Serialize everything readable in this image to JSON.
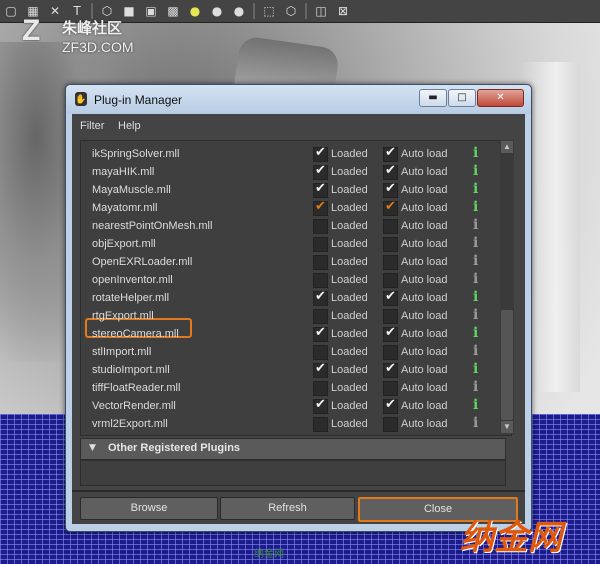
{
  "toolbar": {
    "icons": [
      "select-tool-icon",
      "grid-icon",
      "x-icon",
      "text-icon",
      "wireframe-cube-icon",
      "shaded-cube-icon",
      "textured-cube-icon",
      "checker-icon",
      "light-icon",
      "sphere-icon",
      "sphere-icon",
      "xray-icon",
      "isolate-icon",
      "resolution-gate-icon",
      "film-gate-icon",
      "camera-icon"
    ],
    "glyphs": [
      "▢",
      "▦",
      "✕",
      "T",
      "⬡",
      "■",
      "▣",
      "▩",
      "●",
      "●",
      "●",
      "⬚",
      "⬡",
      "◫",
      "⊠"
    ]
  },
  "watermark_top": {
    "mark": "Z",
    "line1": "朱峰社区",
    "line2": "ZF3D.COM"
  },
  "watermark_bottom": {
    "text": "纳金网"
  },
  "watermark_small": {
    "text": "纳金网"
  },
  "dialog": {
    "title": "Plug-in Manager",
    "window_buttons": {
      "minimize": "▬",
      "maximize": "□",
      "close": "✕"
    },
    "menu": {
      "filter": "Filter",
      "help": "Help"
    },
    "loaded_label": "Loaded",
    "auto_label": "Auto load",
    "info_glyph": "i",
    "plugins": [
      {
        "name": "ikSpringSolver.mll",
        "loaded": true,
        "auto": true
      },
      {
        "name": "mayaHIK.mll",
        "loaded": true,
        "auto": true
      },
      {
        "name": "MayaMuscle.mll",
        "loaded": true,
        "auto": true
      },
      {
        "name": "Mayatomr.mll",
        "loaded": true,
        "auto": true,
        "highlighted": true
      },
      {
        "name": "nearestPointOnMesh.mll",
        "loaded": false,
        "auto": false
      },
      {
        "name": "objExport.mll",
        "loaded": false,
        "auto": false
      },
      {
        "name": "OpenEXRLoader.mll",
        "loaded": false,
        "auto": false
      },
      {
        "name": "openInventor.mll",
        "loaded": false,
        "auto": false
      },
      {
        "name": "rotateHelper.mll",
        "loaded": true,
        "auto": true
      },
      {
        "name": "rtgExport.mll",
        "loaded": false,
        "auto": false
      },
      {
        "name": "stereoCamera.mll",
        "loaded": true,
        "auto": true
      },
      {
        "name": "stlImport.mll",
        "loaded": false,
        "auto": false
      },
      {
        "name": "studioImport.mll",
        "loaded": true,
        "auto": true
      },
      {
        "name": "tiffFloatReader.mll",
        "loaded": false,
        "auto": false
      },
      {
        "name": "VectorRender.mll",
        "loaded": true,
        "auto": true
      },
      {
        "name": "vrml2Export.mll",
        "loaded": false,
        "auto": false
      }
    ],
    "section_label": "Other Registered Plugins",
    "buttons": {
      "browse": "Browse",
      "refresh": "Refresh",
      "close": "Close"
    },
    "colors": {
      "highlight": "#e07a1c",
      "info_on": "#5fd35f",
      "info_off": "#9a9a9a"
    }
  }
}
